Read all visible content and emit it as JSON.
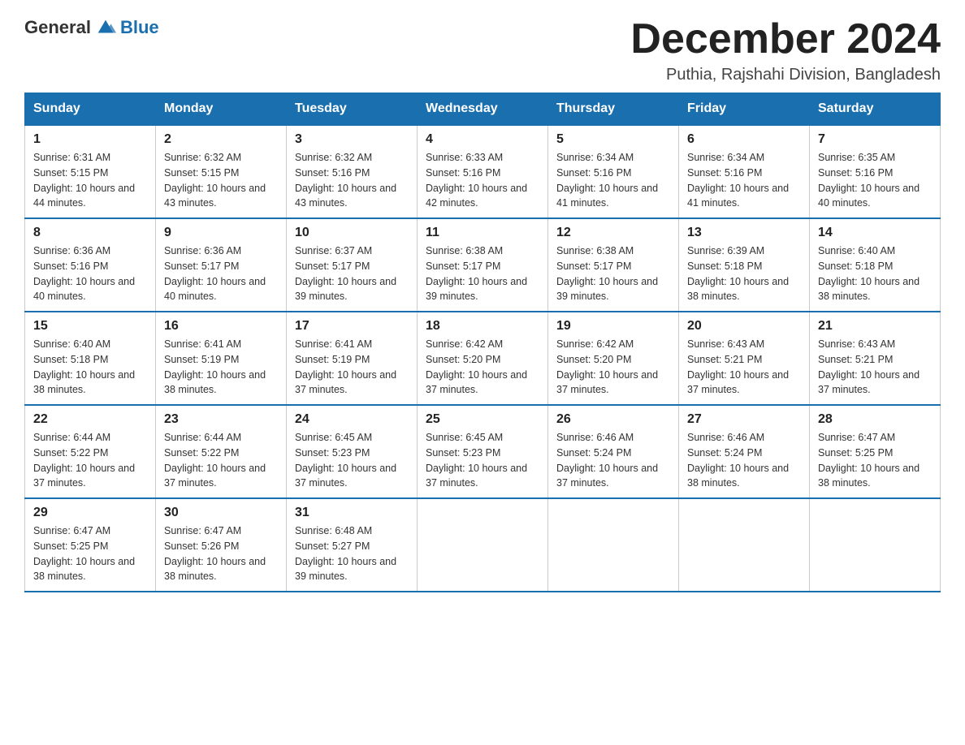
{
  "header": {
    "logo_general": "General",
    "logo_blue": "Blue",
    "month_title": "December 2024",
    "location": "Puthia, Rajshahi Division, Bangladesh"
  },
  "days_of_week": [
    "Sunday",
    "Monday",
    "Tuesday",
    "Wednesday",
    "Thursday",
    "Friday",
    "Saturday"
  ],
  "weeks": [
    [
      {
        "day": "1",
        "sunrise": "6:31 AM",
        "sunset": "5:15 PM",
        "daylight": "10 hours and 44 minutes."
      },
      {
        "day": "2",
        "sunrise": "6:32 AM",
        "sunset": "5:15 PM",
        "daylight": "10 hours and 43 minutes."
      },
      {
        "day": "3",
        "sunrise": "6:32 AM",
        "sunset": "5:16 PM",
        "daylight": "10 hours and 43 minutes."
      },
      {
        "day": "4",
        "sunrise": "6:33 AM",
        "sunset": "5:16 PM",
        "daylight": "10 hours and 42 minutes."
      },
      {
        "day": "5",
        "sunrise": "6:34 AM",
        "sunset": "5:16 PM",
        "daylight": "10 hours and 41 minutes."
      },
      {
        "day": "6",
        "sunrise": "6:34 AM",
        "sunset": "5:16 PM",
        "daylight": "10 hours and 41 minutes."
      },
      {
        "day": "7",
        "sunrise": "6:35 AM",
        "sunset": "5:16 PM",
        "daylight": "10 hours and 40 minutes."
      }
    ],
    [
      {
        "day": "8",
        "sunrise": "6:36 AM",
        "sunset": "5:16 PM",
        "daylight": "10 hours and 40 minutes."
      },
      {
        "day": "9",
        "sunrise": "6:36 AM",
        "sunset": "5:17 PM",
        "daylight": "10 hours and 40 minutes."
      },
      {
        "day": "10",
        "sunrise": "6:37 AM",
        "sunset": "5:17 PM",
        "daylight": "10 hours and 39 minutes."
      },
      {
        "day": "11",
        "sunrise": "6:38 AM",
        "sunset": "5:17 PM",
        "daylight": "10 hours and 39 minutes."
      },
      {
        "day": "12",
        "sunrise": "6:38 AM",
        "sunset": "5:17 PM",
        "daylight": "10 hours and 39 minutes."
      },
      {
        "day": "13",
        "sunrise": "6:39 AM",
        "sunset": "5:18 PM",
        "daylight": "10 hours and 38 minutes."
      },
      {
        "day": "14",
        "sunrise": "6:40 AM",
        "sunset": "5:18 PM",
        "daylight": "10 hours and 38 minutes."
      }
    ],
    [
      {
        "day": "15",
        "sunrise": "6:40 AM",
        "sunset": "5:18 PM",
        "daylight": "10 hours and 38 minutes."
      },
      {
        "day": "16",
        "sunrise": "6:41 AM",
        "sunset": "5:19 PM",
        "daylight": "10 hours and 38 minutes."
      },
      {
        "day": "17",
        "sunrise": "6:41 AM",
        "sunset": "5:19 PM",
        "daylight": "10 hours and 37 minutes."
      },
      {
        "day": "18",
        "sunrise": "6:42 AM",
        "sunset": "5:20 PM",
        "daylight": "10 hours and 37 minutes."
      },
      {
        "day": "19",
        "sunrise": "6:42 AM",
        "sunset": "5:20 PM",
        "daylight": "10 hours and 37 minutes."
      },
      {
        "day": "20",
        "sunrise": "6:43 AM",
        "sunset": "5:21 PM",
        "daylight": "10 hours and 37 minutes."
      },
      {
        "day": "21",
        "sunrise": "6:43 AM",
        "sunset": "5:21 PM",
        "daylight": "10 hours and 37 minutes."
      }
    ],
    [
      {
        "day": "22",
        "sunrise": "6:44 AM",
        "sunset": "5:22 PM",
        "daylight": "10 hours and 37 minutes."
      },
      {
        "day": "23",
        "sunrise": "6:44 AM",
        "sunset": "5:22 PM",
        "daylight": "10 hours and 37 minutes."
      },
      {
        "day": "24",
        "sunrise": "6:45 AM",
        "sunset": "5:23 PM",
        "daylight": "10 hours and 37 minutes."
      },
      {
        "day": "25",
        "sunrise": "6:45 AM",
        "sunset": "5:23 PM",
        "daylight": "10 hours and 37 minutes."
      },
      {
        "day": "26",
        "sunrise": "6:46 AM",
        "sunset": "5:24 PM",
        "daylight": "10 hours and 37 minutes."
      },
      {
        "day": "27",
        "sunrise": "6:46 AM",
        "sunset": "5:24 PM",
        "daylight": "10 hours and 38 minutes."
      },
      {
        "day": "28",
        "sunrise": "6:47 AM",
        "sunset": "5:25 PM",
        "daylight": "10 hours and 38 minutes."
      }
    ],
    [
      {
        "day": "29",
        "sunrise": "6:47 AM",
        "sunset": "5:25 PM",
        "daylight": "10 hours and 38 minutes."
      },
      {
        "day": "30",
        "sunrise": "6:47 AM",
        "sunset": "5:26 PM",
        "daylight": "10 hours and 38 minutes."
      },
      {
        "day": "31",
        "sunrise": "6:48 AM",
        "sunset": "5:27 PM",
        "daylight": "10 hours and 39 minutes."
      },
      {
        "day": "",
        "sunrise": "",
        "sunset": "",
        "daylight": ""
      },
      {
        "day": "",
        "sunrise": "",
        "sunset": "",
        "daylight": ""
      },
      {
        "day": "",
        "sunrise": "",
        "sunset": "",
        "daylight": ""
      },
      {
        "day": "",
        "sunrise": "",
        "sunset": "",
        "daylight": ""
      }
    ]
  ]
}
